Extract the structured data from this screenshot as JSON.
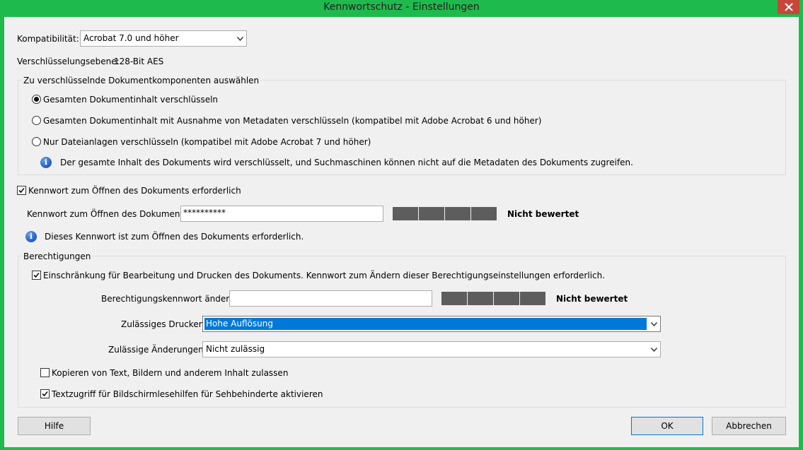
{
  "window": {
    "title": "Kennwortschutz - Einstellungen"
  },
  "compat": {
    "label": "Kompatibilität:",
    "value": "Acrobat 7.0 und höher"
  },
  "encryption": {
    "label": "Verschlüsselungsebene:",
    "value": "128-Bit AES"
  },
  "components": {
    "legend": "Zu verschlüsselnde Dokumentkomponenten auswählen",
    "options": [
      "Gesamten Dokumentinhalt verschlüsseln",
      "Gesamten Dokumentinhalt mit Ausnahme von Metadaten verschlüsseln (kompatibel mit Adobe Acrobat 6 und höher)",
      "Nur Dateianlagen verschlüsseln (kompatibel mit Adobe Acrobat 7 und höher)"
    ],
    "selected_index": 0,
    "info": "Der gesamte Inhalt des Dokuments wird verschlüsselt, und Suchmaschinen können nicht auf die Metadaten des Dokuments zugreifen."
  },
  "open_password": {
    "checkbox_label": "Kennwort zum Öffnen des Dokuments erforderlich",
    "checked": true,
    "field_label": "Kennwort zum Öffnen des Dokuments:",
    "value": "**********",
    "strength": "Nicht bewertet",
    "info": "Dieses Kennwort ist zum Öffnen des Dokuments erforderlich."
  },
  "permissions": {
    "legend": "Berechtigungen",
    "restrict_label": "Einschränkung für Bearbeitung und Drucken des Dokuments. Kennwort zum Ändern dieser Berechtigungseinstellungen erforderlich.",
    "restrict_checked": true,
    "perm_password_label": "Berechtigungskennwort ändern:",
    "perm_password_value": "",
    "strength": "Nicht bewertet",
    "printing_label": "Zulässiges Drucken:",
    "printing_value": "Hohe Auflösung",
    "changes_label": "Zulässige Änderungen:",
    "changes_value": "Nicht zulässig",
    "copy_label": "Kopieren von Text, Bildern und anderem Inhalt zulassen",
    "copy_checked": false,
    "access_label": "Textzugriff für Bildschirmlesehilfen für Sehbehinderte aktivieren",
    "access_checked": true
  },
  "buttons": {
    "help": "Hilfe",
    "ok": "OK",
    "cancel": "Abbrechen"
  },
  "colors": {
    "titlebar": "#1fba4e",
    "close": "#c7463a",
    "selection": "#0078d7",
    "meter": "#5d5d5d"
  }
}
